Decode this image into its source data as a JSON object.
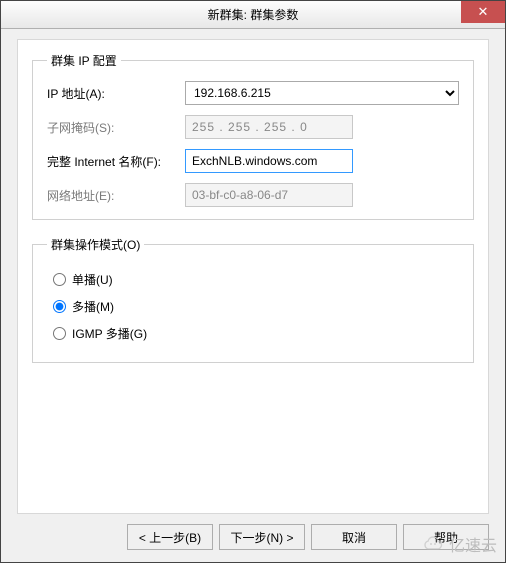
{
  "title": "新群集: 群集参数",
  "close_glyph": "✕",
  "group_ip": {
    "legend": "群集 IP 配置",
    "ip_label": "IP 地址(A):",
    "ip_value": "192.168.6.215",
    "subnet_label": "子网掩码(S):",
    "subnet_value": "255 . 255 . 255 .  0",
    "fqdn_label": "完整 Internet 名称(F):",
    "fqdn_value": "ExchNLB.windows.com",
    "mac_label": "网络地址(E):",
    "mac_value": "03-bf-c0-a8-06-d7"
  },
  "group_mode": {
    "legend": "群集操作模式(O)",
    "unicast": "单播(U)",
    "multicast": "多播(M)",
    "igmp": "IGMP 多播(G)",
    "selected": "multicast"
  },
  "buttons": {
    "back": "< 上一步(B)",
    "next": "下一步(N) >",
    "cancel": "取消",
    "help": "帮助"
  },
  "watermark": "亿速云"
}
